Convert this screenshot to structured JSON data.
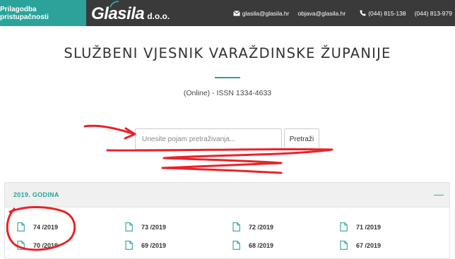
{
  "topbar": {
    "accessibility_label": "Prilagodba pristupačnosti",
    "logo_text": "Glasila",
    "logo_suffix": "d.o.o.",
    "email_1": "glasila@glasila.hr",
    "email_2": "objava@glasila.hr",
    "phone_1": "(044) 815-138",
    "phone_2": "(044) 813-979",
    "email_icon": "envelope-icon",
    "phone_icon": "phone-icon"
  },
  "page": {
    "title": "SLUŽBENI VJESNIK VARAŽDINSKE ŽUPANIJE",
    "issn": "(Online) - ISSN 1334-4633"
  },
  "search": {
    "placeholder": "Unesite pojam pretraživanja...",
    "value": "",
    "button_label": "Pretraži"
  },
  "year_panel": {
    "title": "2019. GODINA",
    "toggle_symbol": "—",
    "issues": [
      {
        "label": "74 /2019",
        "icon": "document-icon"
      },
      {
        "label": "73 /2019",
        "icon": "document-icon"
      },
      {
        "label": "72 /2019",
        "icon": "document-icon"
      },
      {
        "label": "71 /2019",
        "icon": "document-icon"
      },
      {
        "label": "70 /2019",
        "icon": "document-icon"
      },
      {
        "label": "69 /2019",
        "icon": "document-icon"
      },
      {
        "label": "68 /2019",
        "icon": "document-icon"
      },
      {
        "label": "67 /2019",
        "icon": "document-icon"
      }
    ]
  },
  "colors": {
    "accent": "#2ba39a",
    "topbar": "#3a3a3a",
    "annotation": "#e8232a"
  }
}
